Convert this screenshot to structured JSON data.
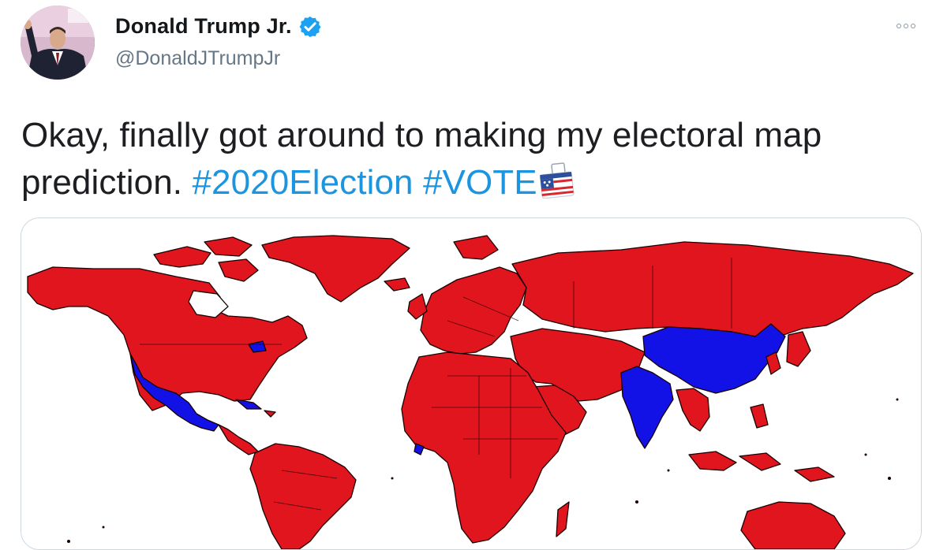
{
  "tweet": {
    "display_name": "Donald Trump Jr.",
    "handle": "@DonaldJTrumpJr",
    "text_main": "Okay, finally got around to making my electoral map prediction.",
    "hashtags": [
      "#2020Election",
      "#VOTE"
    ],
    "verified": true
  },
  "icons": {
    "verified": "verified-badge-icon",
    "more": "more-options-icon",
    "ballot": "ballot-box-emoji"
  },
  "colors": {
    "hashtag": "#1b95e0",
    "verified": "#1da1f2",
    "map_red": "#e0151e",
    "map_blue": "#1212e6",
    "ocean": "#ffffff"
  }
}
